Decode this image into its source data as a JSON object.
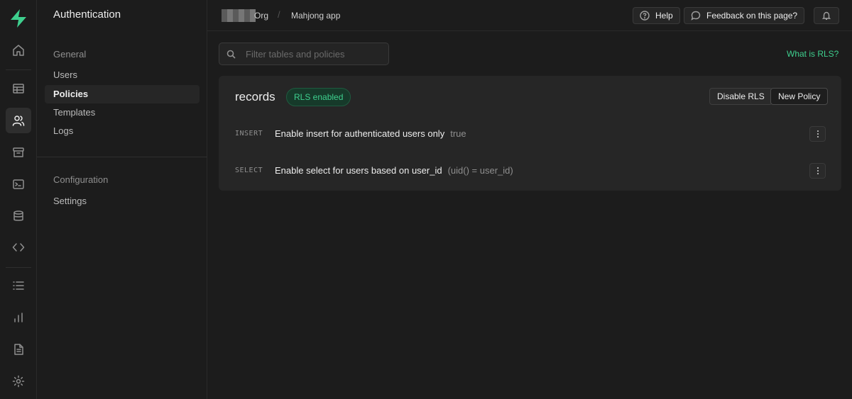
{
  "rail": {
    "logo": "supabase-logo",
    "items": [
      {
        "icon": "home-icon"
      },
      {
        "icon": "table-editor-icon"
      },
      {
        "icon": "authentication-icon",
        "active": true
      },
      {
        "icon": "storage-icon"
      },
      {
        "icon": "sql-editor-icon"
      },
      {
        "icon": "database-icon"
      },
      {
        "icon": "api-icon"
      },
      {
        "icon": "logs-icon"
      },
      {
        "icon": "reports-icon"
      },
      {
        "icon": "docs-icon"
      },
      {
        "icon": "settings-icon"
      }
    ]
  },
  "sidebar": {
    "title": "Authentication",
    "general_label": "General",
    "general_items": [
      {
        "label": "Users"
      },
      {
        "label": "Policies",
        "active": true
      },
      {
        "label": "Templates"
      },
      {
        "label": "Logs"
      }
    ],
    "configuration_label": "Configuration",
    "configuration_items": [
      {
        "label": "Settings"
      }
    ]
  },
  "topbar": {
    "org_label": "Org",
    "separator": "/",
    "project_label": "Mahjong app",
    "help_label": "Help",
    "feedback_label": "Feedback on this page?"
  },
  "main": {
    "search_placeholder": "Filter tables and policies",
    "rls_link": "What is RLS?",
    "table": {
      "name": "records",
      "status_badge": "RLS enabled",
      "disable_label": "Disable RLS",
      "new_policy_label": "New Policy",
      "policies": [
        {
          "command": "INSERT",
          "name": "Enable insert for authenticated users only",
          "definition": "true"
        },
        {
          "command": "SELECT",
          "name": "Enable select for users based on user_id",
          "definition": "(uid() = user_id)"
        }
      ]
    }
  },
  "colors": {
    "background": "#1c1c1c",
    "panel": "#262626",
    "accent": "#3ecf8e"
  }
}
